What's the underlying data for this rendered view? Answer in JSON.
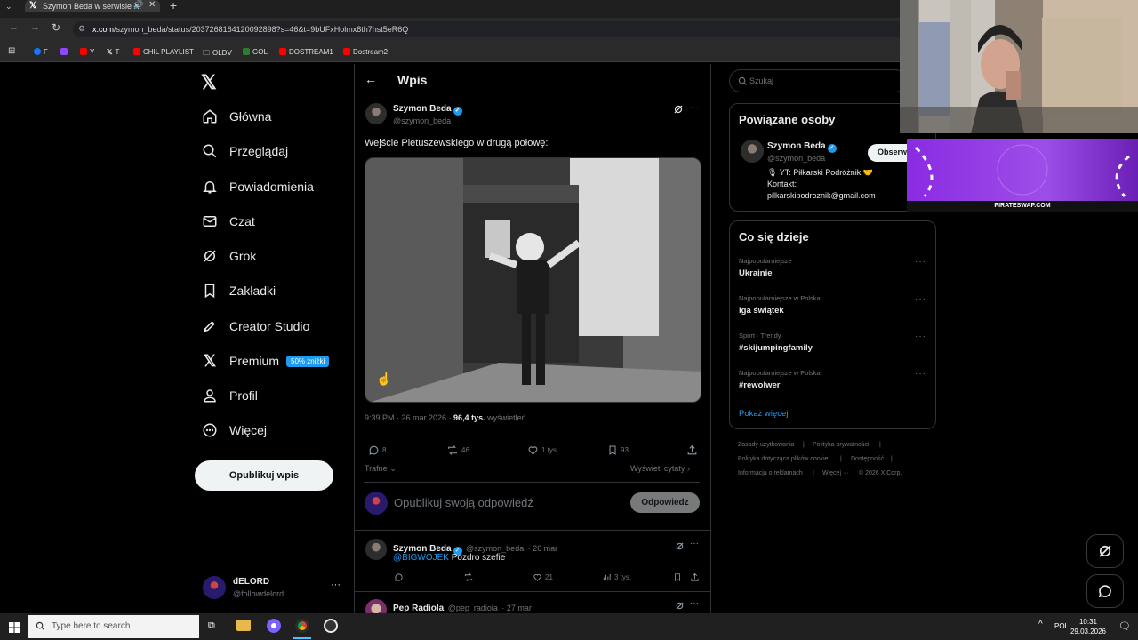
{
  "browser": {
    "tab_title": "Szymon Beda w serwisie X:",
    "url_domain": "x.com",
    "url_path": "/szymon_beda/status/2037268164120092898?s=46&t=9bUFxHolmx8th7hst5eR6Q",
    "bookmarks": [
      "F",
      "Y",
      "T",
      "CHIL PLAYLIST",
      "OLDV",
      "GOL",
      "DOSTREAM1",
      "Dostream2"
    ]
  },
  "nav": {
    "items": [
      "Główna",
      "Przeglądaj",
      "Powiadomienia",
      "Czat",
      "Grok",
      "Zakładki",
      "Creator Studio",
      "Premium",
      "Profil",
      "Więcej"
    ],
    "premium_badge": "50% zniżki",
    "publish_label": "Opublikuj wpis",
    "account_name": "dELORD",
    "account_handle": "@followdelord"
  },
  "post": {
    "header_title": "Wpis",
    "author_name": "Szymon Beda",
    "author_handle": "@szymon_beda",
    "text": "Wejście Pietuszewskiego w drugą połowę:",
    "timestamp": "9:39 PM · 26 mar 2026 · ",
    "views_value": "96,4 tys.",
    "views_label": "wyświetleń",
    "replies": "8",
    "reposts": "46",
    "likes": "1 tys.",
    "bookmarks": "93",
    "sort_label": "Trafne",
    "quotes_label": "Wyświetl cytaty",
    "reply_placeholder": "Opublikuj swoją odpowiedź",
    "reply_button": "Odpowiedz"
  },
  "replies": [
    {
      "name": "Szymon Beda",
      "handle": "@szymon_beda",
      "date": "· 26 mar",
      "mention": "@BIGWOJEK",
      "text": " Pozdro szefie",
      "likes": "21",
      "views": "3 tys."
    },
    {
      "name": "Pep Radiola",
      "handle": "@pep_radiola",
      "date": "· 27 mar"
    }
  ],
  "sidebar": {
    "search_placeholder": "Szukaj",
    "related_title": "Powiązane osoby",
    "related_name": "Szymon Beda",
    "related_handle": "@szymon_beda",
    "follow_label": "Obserwuj",
    "bio_line1": "YT: Piłkarski Podróżnik",
    "bio_line2": "Kontakt:",
    "bio_line3": "pilkarskipodroznik@gmail.com",
    "trends_title": "Co się dzieje",
    "trends": [
      {
        "context": "Najpopularniejsze",
        "name": "Ukrainie"
      },
      {
        "context": "Najpopularniejsze w Polska",
        "name": "iga świątek"
      },
      {
        "context": "Sport · Trendy",
        "name": "#skijumpingfamily"
      },
      {
        "context": "Najpopularniejsze w Polska",
        "name": "#rewolwer"
      }
    ],
    "show_more": "Pokaż więcej",
    "footer": [
      "Zasady użytkowania",
      "Polityka prywatności",
      "Polityka dotycząca plików cookie",
      "Dostępność",
      "Informacja o reklamach",
      "Więcej ···",
      "© 2026 X Corp."
    ]
  },
  "overlay": {
    "banner_caption": "PIRATESWAP.COM"
  },
  "taskbar": {
    "search_placeholder": "Type here to search",
    "language": "POL",
    "time": "10:31",
    "date": "29.03.2026"
  },
  "colors": {
    "accent": "#1d9bf0",
    "background": "#000000",
    "banner": "#8a2be2"
  }
}
